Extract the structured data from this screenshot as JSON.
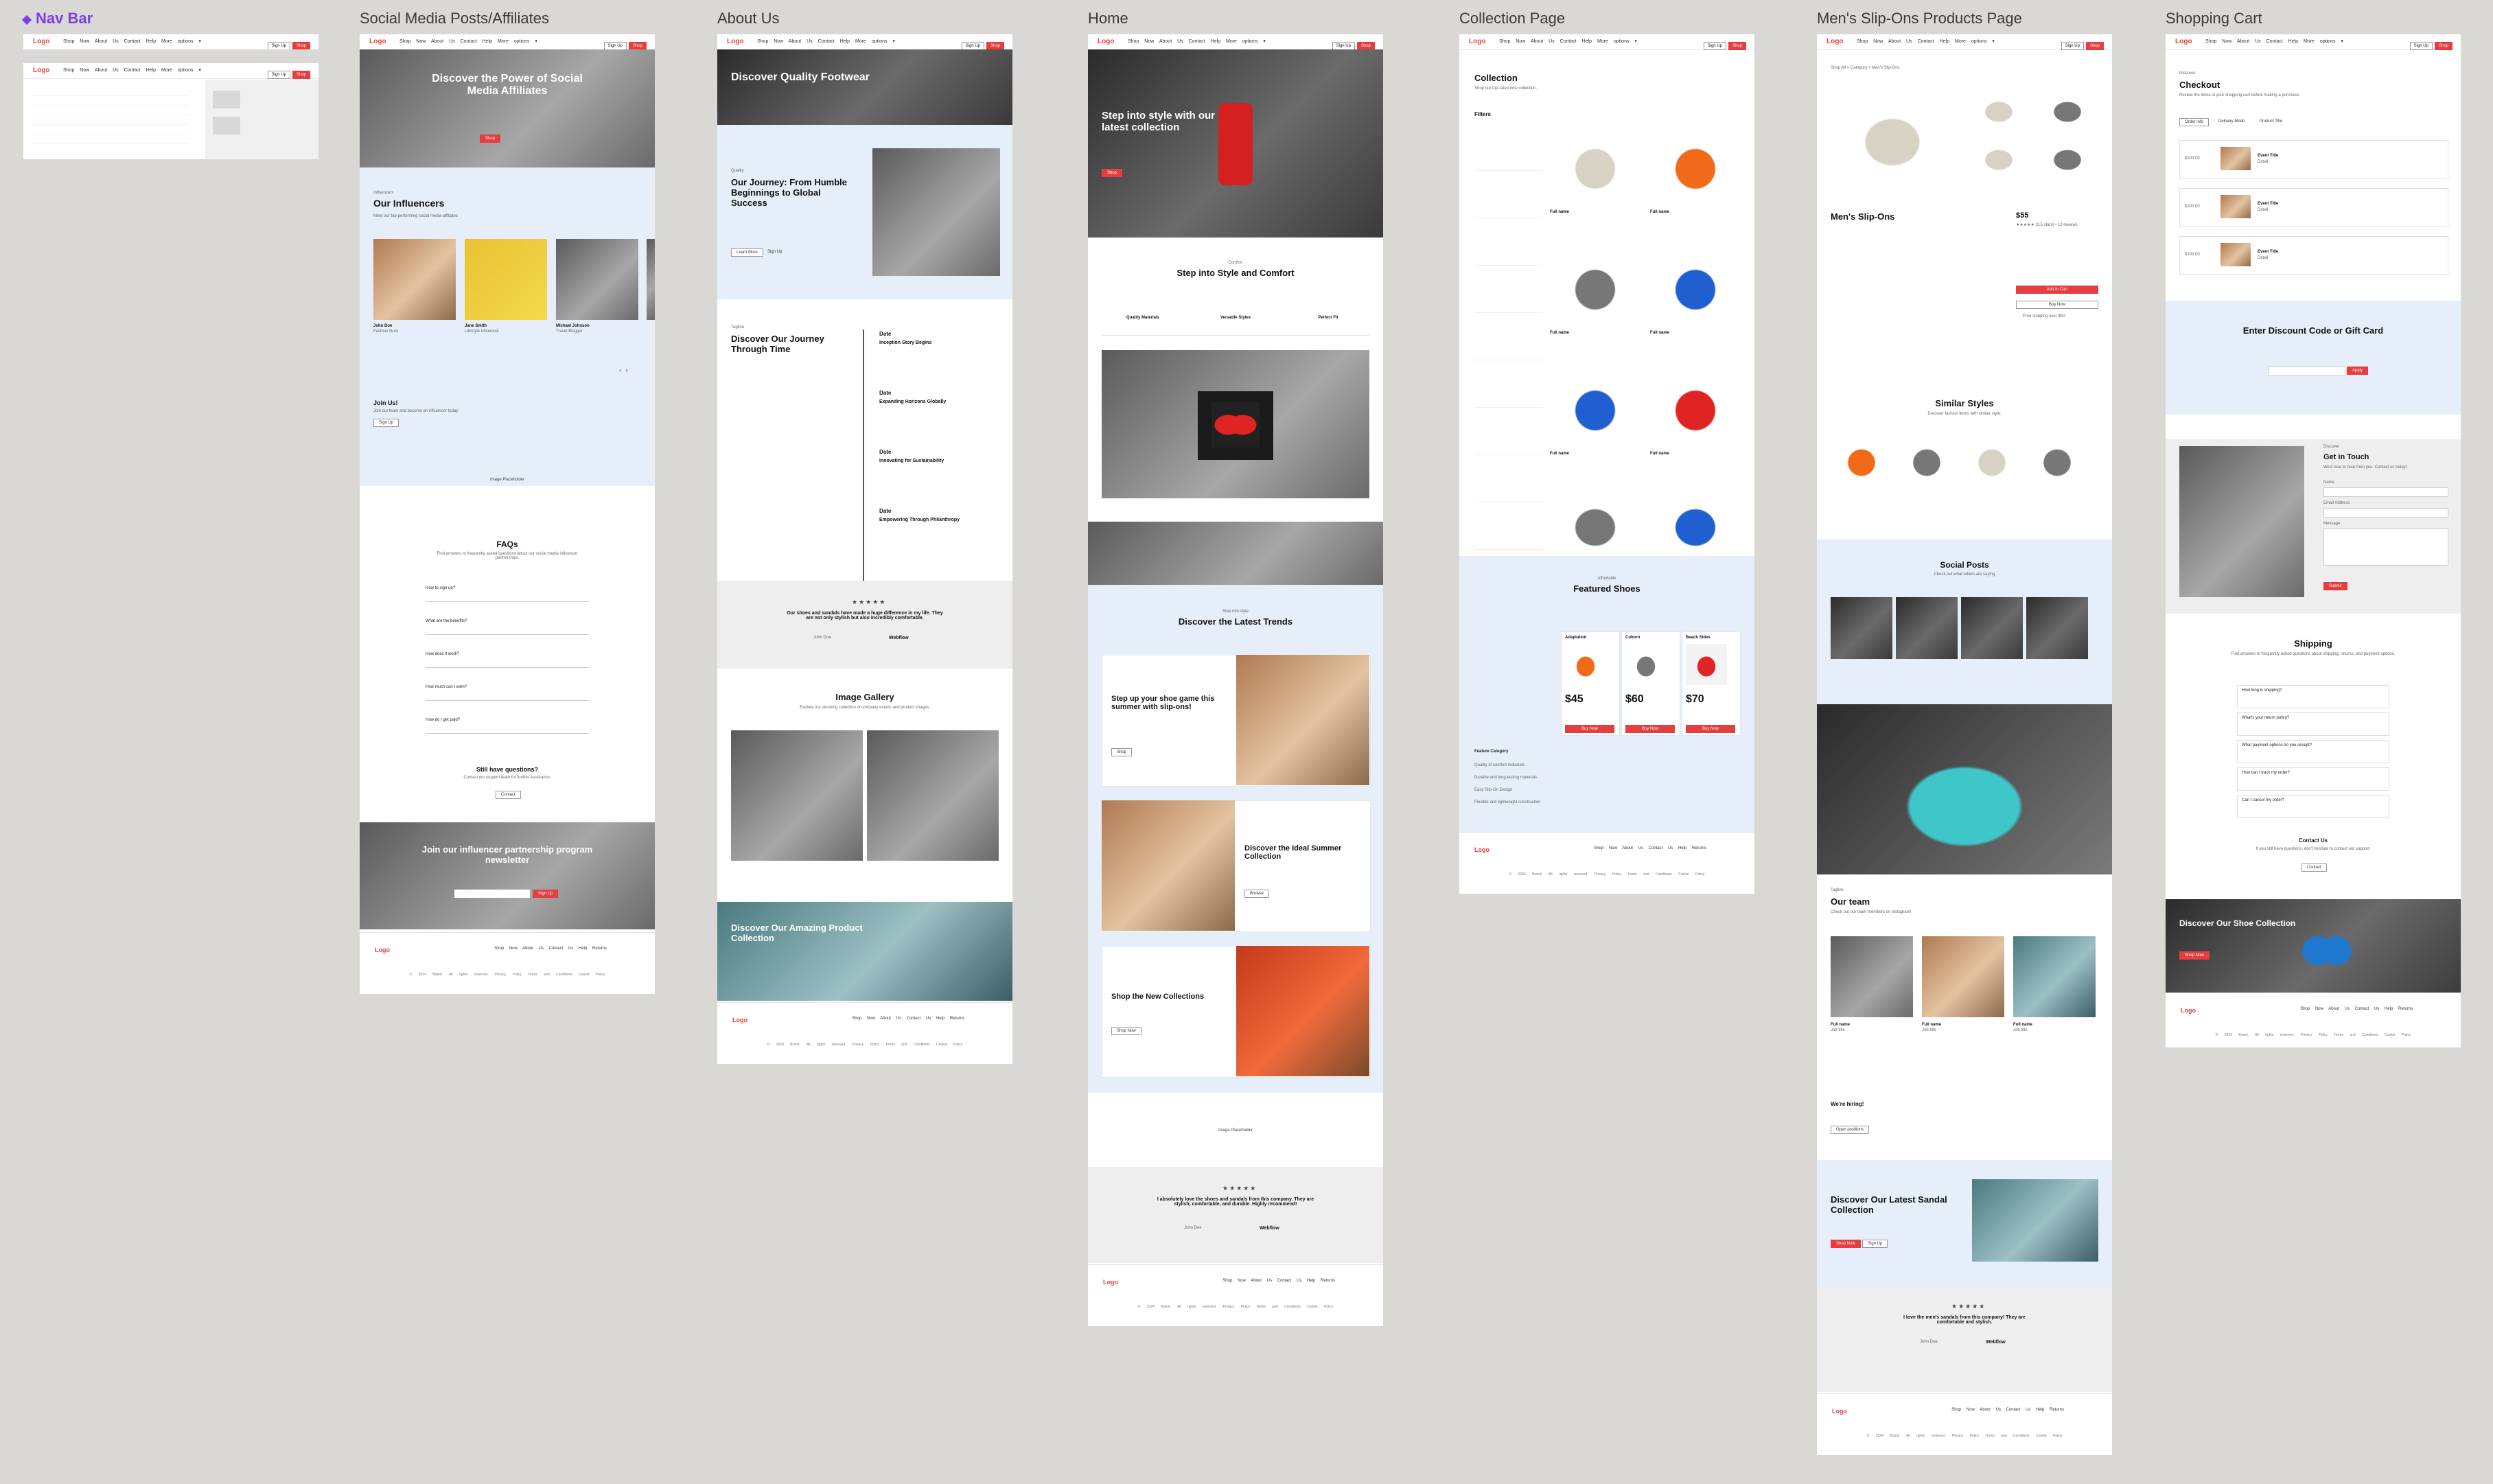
{
  "canvas": {
    "background": "#d9d8d4",
    "accent": "#e53e3e",
    "section_blue": "#e6eef9",
    "component_color": "#7b3fe4"
  },
  "frame_labels": {
    "nav_bar": "Nav Bar",
    "social": "Social Media Posts/Affiliates",
    "about": "About Us",
    "home": "Home",
    "collection": "Collection Page",
    "product": "Men's Slip-Ons Products Page",
    "cart": "Shopping Cart"
  },
  "nav": {
    "logo": "Logo",
    "links": "Shop Now  About Us  Contact  Help  More options ▾",
    "signup": "Sign Up",
    "cta": "Shop"
  },
  "footer": {
    "logo": "Logo",
    "links": "Shop Now  About Us  Contact Us  Help  Returns",
    "legal": "© 2024 Brand. All rights reserved.   Privacy Policy   Terms and Conditions   Cookie Policy"
  },
  "social": {
    "hero_title": "Discover the Power of Social Media Affiliates",
    "influencers_tag": "Influencers",
    "influencers_title": "Our Influencers",
    "influencers_sub": "Meet our top-performing social media affiliates",
    "people": [
      {
        "name": "John Doe",
        "role": "Fashion Guru"
      },
      {
        "name": "Jane Smith",
        "role": "Lifestyle Influencer"
      },
      {
        "name": "Michael Johnson",
        "role": "Travel Blogger"
      }
    ],
    "join_title": "Join Us!",
    "join_sub": "Join our team and become an influencer today",
    "join_btn": "Sign Up",
    "image_placeholder": "Image Placeholder",
    "faq_title": "FAQs",
    "faq_sub": "Find answers to frequently asked questions about our social media influencer partnerships.",
    "faqs": [
      "How to sign up?",
      "What are the benefits?",
      "How does it work?",
      "How much can I earn?",
      "How do I get paid?"
    ],
    "still_title": "Still have questions?",
    "still_sub": "Contact our support team for further assistance.",
    "still_btn": "Contact",
    "newsletter_title": "Join our influencer partnership program newsletter",
    "newsletter_btn": "Sign Up"
  },
  "about": {
    "hero_title": "Discover Quality Footwear",
    "journey_tag": "Quality",
    "journey_title": "Our Journey: From Humble Beginnings to Global Success",
    "learn": "Learn More",
    "signup": "Sign Up",
    "timeline_tag": "Tagline",
    "timeline_title": "Discover Our Journey Through Time",
    "timeline": [
      {
        "date": "Date",
        "title": "Inception Story Begins"
      },
      {
        "date": "Date",
        "title": "Expanding Horizons Globally"
      },
      {
        "date": "Date",
        "title": "Innovating for Sustainability"
      },
      {
        "date": "Date",
        "title": "Empowering Through Philanthropy"
      }
    ],
    "quote": "Our shoes and sandals have made a huge difference in my life. They are not only stylish but also incredibly comfortable.",
    "quote_author": "John Doe",
    "quote_brand": "Webflow",
    "gallery_title": "Image Gallery",
    "gallery_sub": "Explore our stunning collection of company events and product images.",
    "product_title": "Discover Our Amazing Product Collection"
  },
  "home": {
    "hero_title": "Step into style with our latest collection",
    "comfort_tag": "Comfort",
    "comfort_title": "Step into Style and Comfort",
    "columns": [
      "Quality Materials",
      "Versatile Styles",
      "Perfect Fit"
    ],
    "trends_tag": "Step into style",
    "trends_title": "Discover the Latest Trends",
    "cards": [
      {
        "title": "Step up your shoe game this summer with slip-ons!",
        "btn": "Shop"
      },
      {
        "title": "Discover the Ideal Summer Collection",
        "btn": "Browse"
      },
      {
        "title": "Shop the New Collections",
        "btn": "Shop Now"
      }
    ],
    "image_placeholder": "Image Placeholder",
    "quote": "I absolutely love the shoes and sandals from this company. They are stylish, comfortable, and durable. Highly recommend!",
    "quote_author": "John Doe",
    "quote_brand": "Webflow"
  },
  "collection": {
    "title": "Collection",
    "sub": "Shop our top-rated new collection.",
    "filters_label": "Filters",
    "filter_groups": [
      "Filter Type",
      "Filter Type",
      "Filter Type",
      "Filter Type",
      "Filter Type",
      "Filter Type",
      "Filter Type",
      "Filter Type"
    ],
    "product_name": "Full name",
    "product_price": "$55",
    "featured_tag": "Affordable",
    "featured_title": "Featured Shoes",
    "featured": [
      {
        "name": "Adaptation",
        "price": "$45",
        "btn": "Buy Now"
      },
      {
        "name": "Cuborn",
        "price": "$60",
        "btn": "Buy Now"
      },
      {
        "name": "Beach Sides",
        "price": "$70",
        "btn": "Buy Now"
      }
    ],
    "feature_rows": [
      "Feature Category",
      "Quality of comfort materials",
      "Durable and long-lasting materials",
      "Easy Slip-On Design",
      "Flexible and lightweight construction"
    ]
  },
  "product": {
    "breadcrumb": "Shop All  >  Category  >  Men's Slip-Ons",
    "title": "Men's Slip-Ons",
    "price": "$55",
    "rating": "★★★★★ (3.5 stars) • 10 reviews",
    "add_btn": "Add to Cart",
    "buy_btn": "Buy Now",
    "shipping_note": "Free shipping over $50",
    "similar_title": "Similar Styles",
    "similar_sub": "Discover fashion items with similar style.",
    "social_title": "Social Posts",
    "social_sub": "Check out what others are saying",
    "team_tag": "Tagline",
    "team_title": "Our team",
    "team_sub": "Check out our team members on Instagram!",
    "team": [
      {
        "name": "Full name",
        "role": "Job title"
      },
      {
        "name": "Full name",
        "role": "Job title"
      },
      {
        "name": "Full name",
        "role": "Job title"
      }
    ],
    "hiring_title": "We're hiring!",
    "hiring_btn": "Open positions",
    "sandal_title": "Discover Our Latest Sandal Collection",
    "sandal_btn": "Shop Now",
    "sandal_btn2": "Sign Up",
    "quote": "I love the men's sandals from this company! They are comfortable and stylish.",
    "quote_author": "John Doe",
    "quote_brand": "Webflow"
  },
  "cart": {
    "tag": "Discover",
    "title": "Checkout",
    "sub": "Review the items in your shopping cart before making a purchase.",
    "tabs": [
      "Order Info",
      "Delivery Mode",
      "Product Title"
    ],
    "items": [
      {
        "price": "$100.00",
        "title": "Event Title",
        "meta": "Detail"
      },
      {
        "price": "$100.00",
        "title": "Event Title",
        "meta": "Detail"
      },
      {
        "price": "$100.00",
        "title": "Event Title",
        "meta": "Detail"
      }
    ],
    "discount_title": "Enter Discount Code or Gift Card",
    "discount_btn": "Apply",
    "touch_tag": "Discover",
    "touch_title": "Get in Touch",
    "touch_sub": "We'd love to hear from you. Contact us today!",
    "form": [
      "Name",
      "Email Address",
      "Message"
    ],
    "submit": "Submit",
    "shipping_title": "Shipping",
    "shipping_sub": "Find answers to frequently asked questions about shipping, returns, and payment options.",
    "faqs": [
      "How long is shipping?",
      "What's your return policy?",
      "What payment options do you accept?",
      "How can I track my order?",
      "Can I cancel my order?"
    ],
    "contact_title": "Contact Us",
    "contact_sub": "If you still have questions, don't hesitate to contact our support.",
    "contact_btn": "Contact",
    "shoe_title": "Discover Our Shoe Collection",
    "shoe_btn": "Shop Now"
  }
}
